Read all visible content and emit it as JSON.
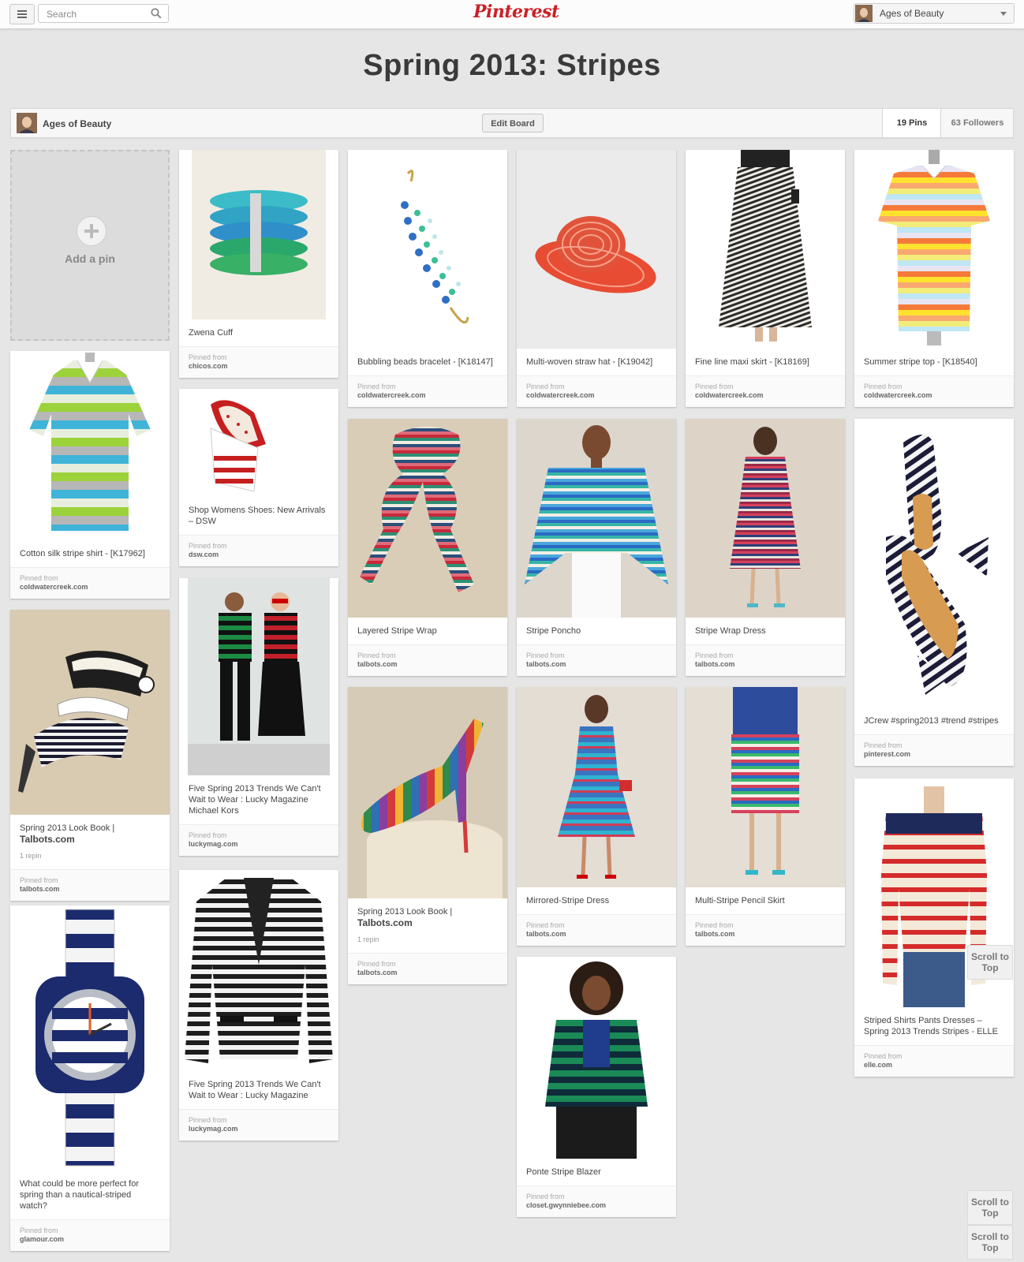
{
  "header": {
    "search_placeholder": "Search",
    "logo": "Pinterest",
    "user_name": "Ages of Beauty"
  },
  "board": {
    "title": "Spring 2013: Stripes",
    "owner": "Ages of Beauty",
    "edit_label": "Edit Board",
    "pins_count": "19 Pins",
    "followers_count": "63 Followers",
    "add_pin_label": "Add a pin"
  },
  "pinned_from_label": "Pinned from",
  "scroll_to_top": "Scroll to Top",
  "pins": [
    {
      "desc": "Cotton silk stripe shirt - [K17962]",
      "source": "coldwatercreek.com"
    },
    {
      "desc": "Spring 2013 Look Book |",
      "desc_bold": "Talbots.com",
      "repin": "1 repin",
      "source": "talbots.com"
    },
    {
      "desc": "What could be more perfect for spring than a nautical-striped watch?",
      "source": "glamour.com"
    },
    {
      "desc": "Zwena Cuff",
      "source": "chicos.com"
    },
    {
      "desc": "Shop Womens Shoes: New Arrivals – DSW",
      "source": "dsw.com"
    },
    {
      "desc": "Five Spring 2013 Trends We Can't Wait to Wear : Lucky Magazine Michael Kors",
      "source": "luckymag.com"
    },
    {
      "desc": "Five Spring 2013 Trends We Can't Wait to Wear : Lucky Magazine",
      "source": "luckymag.com"
    },
    {
      "desc": "Bubbling beads bracelet - [K18147]",
      "source": "coldwatercreek.com"
    },
    {
      "desc": "Layered Stripe Wrap",
      "source": "talbots.com"
    },
    {
      "desc": "Spring 2013 Look Book |",
      "desc_bold": "Talbots.com",
      "repin": "1 repin",
      "source": "talbots.com"
    },
    {
      "desc": "Multi-woven straw hat - [K19042]",
      "source": "coldwatercreek.com"
    },
    {
      "desc": "Stripe Poncho",
      "source": "talbots.com"
    },
    {
      "desc": "Mirrored-Stripe Dress",
      "source": "talbots.com"
    },
    {
      "desc": "Ponte Stripe Blazer",
      "source": "closet.gwynniebee.com"
    },
    {
      "desc": "Fine line maxi skirt - [K18169]",
      "source": "coldwatercreek.com"
    },
    {
      "desc": "Stripe Wrap Dress",
      "source": "talbots.com"
    },
    {
      "desc": "Multi-Stripe Pencil Skirt",
      "source": "talbots.com"
    },
    {
      "desc": "Summer stripe top - [K18540]",
      "source": "coldwatercreek.com"
    },
    {
      "desc": "JCrew #spring2013 #trend #stripes",
      "source": "pinterest.com"
    },
    {
      "desc": "Striped Shirts Pants Dresses – Spring 2013 Trends Stripes - ELLE",
      "source": "elle.com"
    }
  ],
  "colors": {
    "brand": "#cb2027",
    "background": "#e6e6e6"
  }
}
